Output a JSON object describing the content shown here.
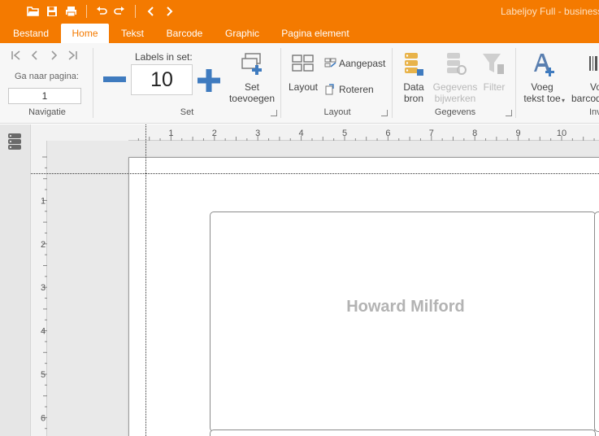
{
  "window": {
    "title": "Labeljoy Full - business"
  },
  "colors": {
    "brand": "#f47a00",
    "accent_blue": "#3f7bbf",
    "ribbon_bg": "#f7f7f7"
  },
  "quick_access": [
    "open-folder-icon",
    "save-icon",
    "print-icon",
    "undo-icon",
    "redo-icon",
    "back-icon",
    "forward-icon"
  ],
  "tabs": [
    "Bestand",
    "Home",
    "Tekst",
    "Barcode",
    "Graphic",
    "Pagina element"
  ],
  "active_tab": "Home",
  "ribbon": {
    "navigatie": {
      "goto_label": "Ga naar pagina:",
      "page_value": "1",
      "group_label": "Navigatie"
    },
    "set": {
      "labels_in_set_label": "Labels in set:",
      "count": "10",
      "add_line1": "Set",
      "add_line2": "toevoegen",
      "group_label": "Set"
    },
    "layout": {
      "layout_label": "Layout",
      "custom_label": "Aangepast",
      "rotate_label": "Roteren",
      "group_label": "Layout"
    },
    "gegevens": {
      "source_line1": "Data",
      "source_line2": "bron",
      "update_line1": "Gegevens",
      "update_line2": "bijwerken",
      "filter_label": "Filter",
      "group_label": "Gegevens"
    },
    "insert": {
      "text_line1": "Voeg",
      "text_line2": "tekst toe",
      "barcode_line1": "Vo",
      "barcode_line2": "barcod",
      "group_label": "Inv"
    }
  },
  "ruler": {
    "h_labels": [
      "1",
      "2",
      "3",
      "4",
      "5",
      "6",
      "7",
      "8",
      "9",
      "10"
    ],
    "v_labels": [
      "1",
      "2",
      "3",
      "4",
      "5",
      "6"
    ]
  },
  "label": {
    "text": "Howard Milford"
  }
}
